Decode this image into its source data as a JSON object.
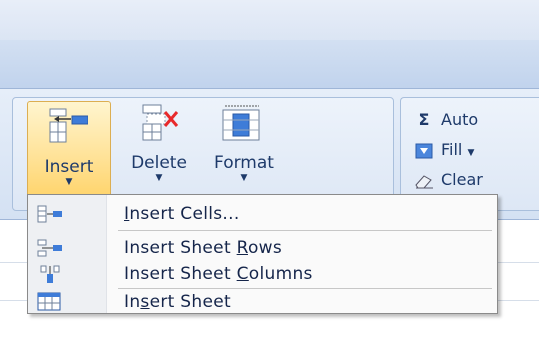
{
  "ribbon": {
    "cells_group": {
      "insert": {
        "label": "Insert",
        "icon": "insert-cells-icon"
      },
      "delete": {
        "label": "Delete",
        "icon": "delete-cells-icon"
      },
      "format": {
        "label": "Format",
        "icon": "format-cells-icon"
      }
    },
    "editing_group": {
      "autosum": {
        "label": "Auto",
        "icon": "sigma-icon"
      },
      "fill": {
        "label": "Fill",
        "icon": "fill-down-icon"
      },
      "clear": {
        "label": "Clear",
        "icon": "eraser-icon"
      }
    }
  },
  "insert_menu": {
    "items": [
      {
        "pre": "",
        "key": "I",
        "post": "nsert Cells...",
        "icon": "insert-cells-small-icon"
      },
      {
        "pre": "Insert Sheet ",
        "key": "R",
        "post": "ows",
        "icon": "insert-rows-icon"
      },
      {
        "pre": "Insert Sheet ",
        "key": "C",
        "post": "olumns",
        "icon": "insert-columns-icon"
      },
      {
        "pre": "In",
        "key": "s",
        "post": "ert Sheet",
        "icon": "insert-sheet-icon"
      }
    ]
  },
  "colors": {
    "accent_highlight": "#ffd46b",
    "ribbon_bg": "#d4e1f3",
    "menu_text": "#15254a",
    "delete_x": "#e8292b"
  }
}
